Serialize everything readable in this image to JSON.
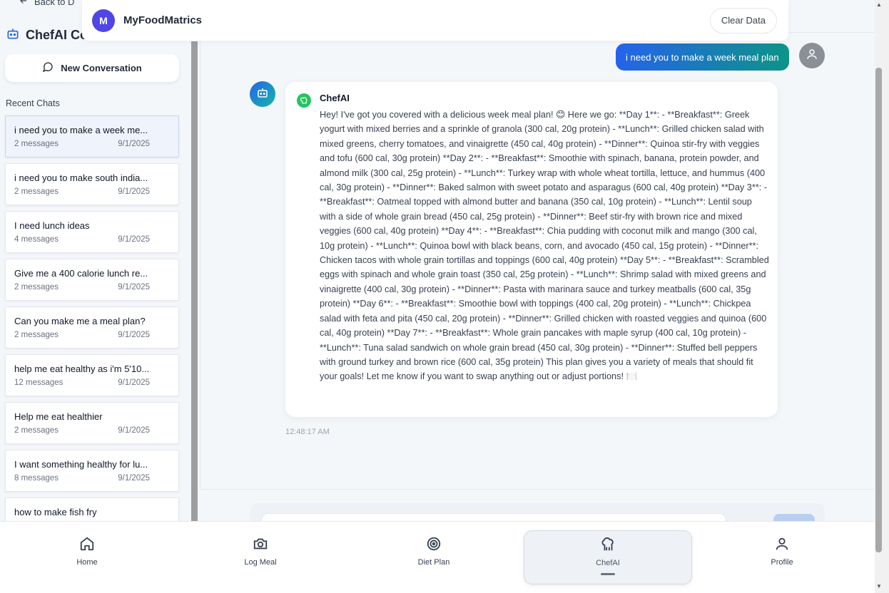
{
  "header": {
    "avatar_letter": "M",
    "app_title": "MyFoodMatrics",
    "clear_button": "Clear Data"
  },
  "sidebar": {
    "back_label": "Back to D",
    "title": "ChefAI Co",
    "new_conversation": "New Conversation",
    "recent_label": "Recent Chats",
    "chats": [
      {
        "title": "i need you to make a week me...",
        "messages": "2 messages",
        "date": "9/1/2025"
      },
      {
        "title": "i need you to make south india...",
        "messages": "2 messages",
        "date": "9/1/2025"
      },
      {
        "title": "I need lunch ideas",
        "messages": "4 messages",
        "date": "9/1/2025"
      },
      {
        "title": "Give me a 400 calorie lunch re...",
        "messages": "2 messages",
        "date": "9/1/2025"
      },
      {
        "title": "Can you make me a meal plan?",
        "messages": "2 messages",
        "date": "9/1/2025"
      },
      {
        "title": "help me eat healthy as i'm 5'10...",
        "messages": "12 messages",
        "date": "9/1/2025"
      },
      {
        "title": "Help me eat healthier",
        "messages": "2 messages",
        "date": "9/1/2025"
      },
      {
        "title": "I want something healthy for lu...",
        "messages": "8 messages",
        "date": "9/1/2025"
      },
      {
        "title": "how to make fish fry",
        "messages": "",
        "date": ""
      }
    ]
  },
  "chat": {
    "user_message": "i need you to make a week meal plan",
    "bot_name": "ChefAI",
    "bot_message": "Hey! I've got you covered with a delicious week meal plan! 😊 Here we go: **Day 1**: - **Breakfast**: Greek yogurt with mixed berries and a sprinkle of granola (300 cal, 20g protein) - **Lunch**: Grilled chicken salad with mixed greens, cherry tomatoes, and vinaigrette (450 cal, 40g protein) - **Dinner**: Quinoa stir-fry with veggies and tofu (600 cal, 30g protein) **Day 2**: - **Breakfast**: Smoothie with spinach, banana, protein powder, and almond milk (300 cal, 25g protein) - **Lunch**: Turkey wrap with whole wheat tortilla, lettuce, and hummus (400 cal, 30g protein) - **Dinner**: Baked salmon with sweet potato and asparagus (600 cal, 40g protein) **Day 3**: - **Breakfast**: Oatmeal topped with almond butter and banana (350 cal, 10g protein) - **Lunch**: Lentil soup with a side of whole grain bread (450 cal, 25g protein) - **Dinner**: Beef stir-fry with brown rice and mixed veggies (600 cal, 40g protein) **Day 4**: - **Breakfast**: Chia pudding with coconut milk and mango (300 cal, 10g protein) - **Lunch**: Quinoa bowl with black beans, corn, and avocado (450 cal, 15g protein) - **Dinner**: Chicken tacos with whole grain tortillas and toppings (600 cal, 40g protein) **Day 5**: - **Breakfast**: Scrambled eggs with spinach and whole grain toast (350 cal, 25g protein) - **Lunch**: Shrimp salad with mixed greens and vinaigrette (400 cal, 30g protein) - **Dinner**: Pasta with marinara sauce and turkey meatballs (600 cal, 35g protein) **Day 6**: - **Breakfast**: Smoothie bowl with toppings (400 cal, 20g protein) - **Lunch**: Chickpea salad with feta and pita (450 cal, 20g protein) - **Dinner**: Grilled chicken with roasted veggies and quinoa (600 cal, 40g protein) **Day 7**: - **Breakfast**: Whole grain pancakes with maple syrup (400 cal, 10g protein) - **Lunch**: Tuna salad sandwich on whole grain bread (450 cal, 30g protein) - **Dinner**: Stuffed bell peppers with ground turkey and brown rice (600 cal, 35g protein) This plan gives you a variety of meals that should fit your goals! Let me know if you want to swap anything out or adjust portions! 🍽️",
    "timestamp": "12:48:17 AM"
  },
  "nav": {
    "items": [
      {
        "label": "Home",
        "icon": "home-icon"
      },
      {
        "label": "Log Meal",
        "icon": "camera-icon"
      },
      {
        "label": "Diet Plan",
        "icon": "target-icon"
      },
      {
        "label": "ChefAI",
        "icon": "chef-icon"
      },
      {
        "label": "Profile",
        "icon": "user-icon"
      }
    ],
    "active": "ChefAI"
  },
  "colors": {
    "accent_gradient_start": "#2563eb",
    "accent_gradient_end": "#0d9488",
    "avatar_purple": "#4f46e5",
    "bot_badge_green": "#22c55e"
  }
}
